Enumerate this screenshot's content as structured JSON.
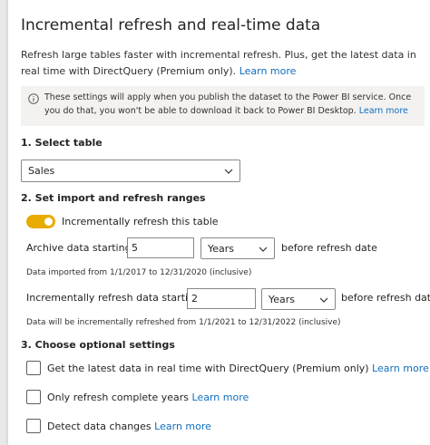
{
  "dialog": {
    "title": "Incremental refresh and real-time data",
    "description": "Refresh large tables faster with incremental refresh. Plus, get the latest data in real time with DirectQuery (Premium only).",
    "learn_more": "Learn more",
    "info_text": "These settings will apply when you publish the dataset to the Power BI service. Once you do that, you won't be able to download it back to Power BI Desktop.",
    "info_learn_more": "Learn more"
  },
  "step1": {
    "heading": "1. Select table",
    "table_value": "Sales"
  },
  "step2": {
    "heading": "2. Set import and refresh ranges",
    "toggle_label": "Incrementally refresh this table",
    "toggle_on": true,
    "archive_label": "Archive data starting",
    "archive_value": "5",
    "archive_unit": "Years",
    "archive_suffix": "before refresh date",
    "archive_note": "Data imported from 1/1/2017 to 12/31/2020 (inclusive)",
    "incr_label": "Incrementally refresh data starting",
    "incr_value": "2",
    "incr_unit": "Years",
    "incr_suffix": "before refresh date",
    "incr_note": "Data will be incrementally refreshed from 1/1/2021 to 12/31/2022 (inclusive)"
  },
  "step3": {
    "heading": "3. Choose optional settings",
    "options": [
      {
        "label": "Get the latest data in real time with DirectQuery (Premium only)",
        "link": "Learn more",
        "checked": false
      },
      {
        "label": "Only refresh complete years",
        "link": "Learn more",
        "checked": false
      },
      {
        "label": "Detect data changes",
        "link": "Learn more",
        "checked": false
      }
    ]
  },
  "colors": {
    "accent_toggle": "#e8ab00",
    "link": "#106ebe"
  }
}
